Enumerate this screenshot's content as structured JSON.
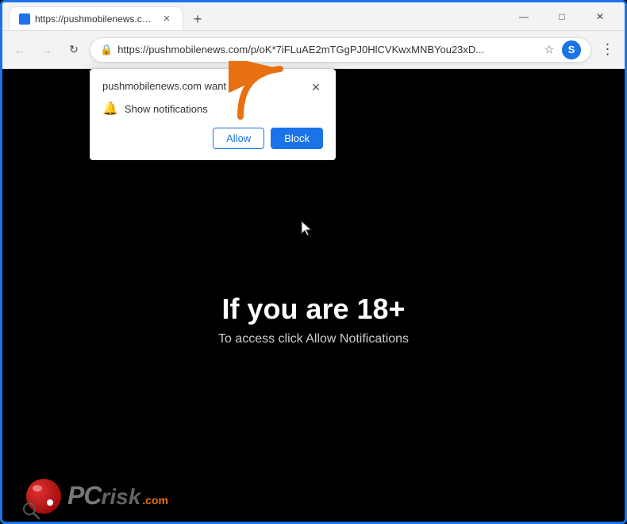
{
  "browser": {
    "tab": {
      "title": "https://pushmobilenews.com/p/..."
    },
    "address": "https://pushmobilenews.com/p/oK*7iFLuAE2mTGgPJ0HlCVKwxMNBYou23xD...",
    "new_tab_label": "+",
    "window_controls": {
      "minimize": "—",
      "maximize": "□",
      "close": "✕"
    },
    "nav": {
      "back": "←",
      "forward": "→",
      "refresh": "↻"
    }
  },
  "notification_popup": {
    "title": "pushmobilenews.com want",
    "close_label": "✕",
    "notification_row_label": "Show notifications",
    "allow_label": "Allow",
    "block_label": "Block"
  },
  "webpage": {
    "main_text": "If you are 18+",
    "sub_text": "To access click Allow Notifications"
  },
  "pcrisk": {
    "letters": "PC",
    "suffix": "risk",
    "dotcom": ".com"
  },
  "icons": {
    "lock": "🔒",
    "star": "☆",
    "bell": "🔔",
    "profile": "S",
    "more": "⋮"
  }
}
